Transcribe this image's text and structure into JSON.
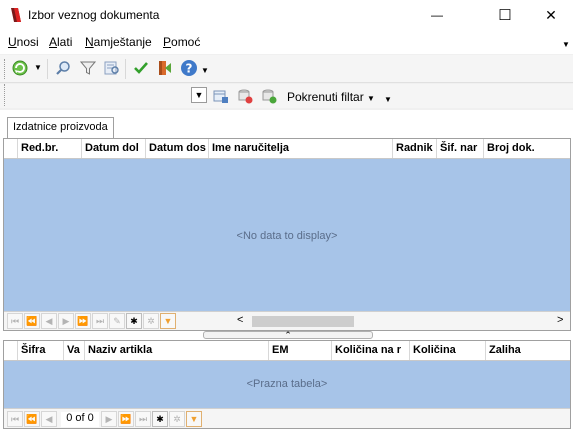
{
  "window": {
    "title": "Izbor veznog dokumenta",
    "minimize_glyph": "—",
    "maximize_glyph": "☐",
    "close_glyph": "✕"
  },
  "menu": {
    "items": [
      {
        "label": "Unosi",
        "underline": "U",
        "rest": "nosi"
      },
      {
        "label": "Alati",
        "underline": "A",
        "rest": "lati"
      },
      {
        "label": "Namještanje",
        "underline": "N",
        "rest": "amještanje"
      },
      {
        "label": "Pomoć",
        "underline": "P",
        "rest": "omoć"
      }
    ]
  },
  "toolbar2": {
    "filter_label": "Pokrenuti filtar"
  },
  "tabs": [
    {
      "label": "Izdatnice proizvoda",
      "active": true
    }
  ],
  "upper_grid": {
    "columns": [
      "Red.br.",
      "Datum dol",
      "Datum dos",
      "Ime naručitelja",
      "Radnik",
      "Šif. nar",
      "Broj dok."
    ],
    "empty_text": "<No data to display>"
  },
  "lower_grid": {
    "columns": [
      "Šifra",
      "Va",
      "Naziv artikla",
      "EM",
      "Količina na r",
      "Količina",
      "Zaliha"
    ],
    "empty_text": "<Prazna tabela>",
    "record_counter": "0 of 0"
  },
  "colors": {
    "data_area": "#a7c4e8",
    "filter_orange": "#f0a030"
  },
  "icons": [
    "app-icon",
    "refresh-icon",
    "search-icon",
    "filter-icon",
    "check-icon",
    "exit-icon",
    "help-icon"
  ]
}
